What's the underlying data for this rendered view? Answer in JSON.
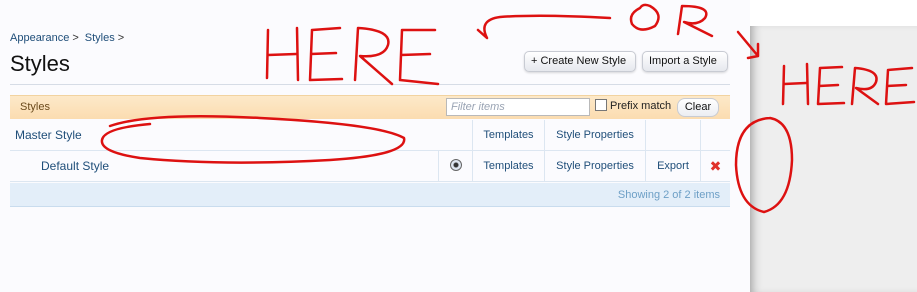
{
  "breadcrumb": {
    "items": [
      "Appearance",
      "Styles"
    ],
    "separator": ">"
  },
  "page": {
    "title": "Styles"
  },
  "actions": {
    "create_label": "+ Create New Style",
    "import_label": "Import a Style"
  },
  "list": {
    "header_label": "Styles",
    "filter_placeholder": "Filter items",
    "prefix_match_label": "Prefix match",
    "clear_label": "Clear",
    "rows": [
      {
        "name": "Master Style",
        "templates": "Templates",
        "properties": "Style Properties"
      },
      {
        "name": "Default Style",
        "default_selected": true,
        "templates": "Templates",
        "properties": "Style Properties",
        "export": "Export",
        "delete_icon": "delete-x-icon"
      }
    ],
    "footer": "Showing 2 of 2 items"
  },
  "annotations": {
    "left_word": "HERE",
    "top_word": "OR",
    "right_word": "HERE",
    "ink_color": "#dd1111"
  },
  "colors": {
    "link": "#1f4e79",
    "header_bg": "#fde9c9",
    "footer_bg": "#e3eef9",
    "delete": "#e0322b"
  }
}
